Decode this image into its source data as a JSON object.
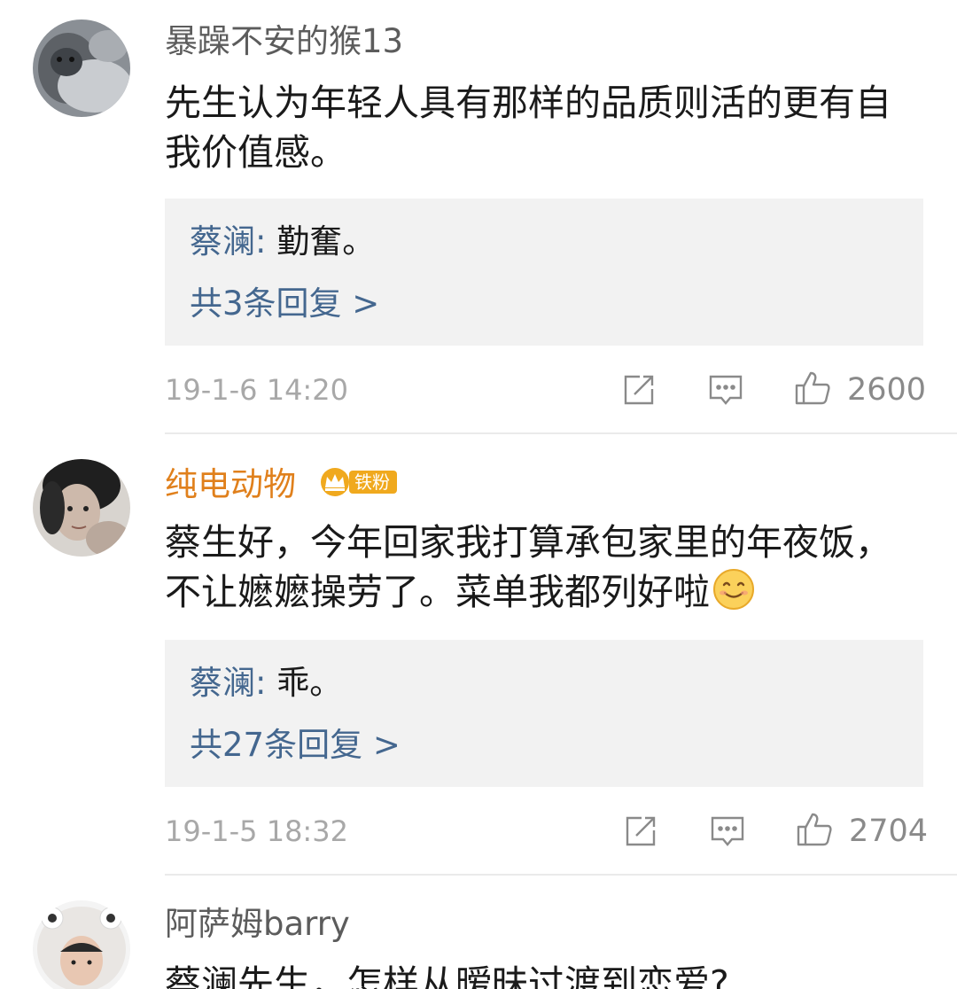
{
  "comments": [
    {
      "username": "暴躁不安的猴13",
      "text": "先生认为年轻人具有那样的品质则活的更有自我价值感。",
      "reply": {
        "author": "蔡澜",
        "separator": ": ",
        "text": "勤奮。"
      },
      "reply_count_label": "共3条回复 >",
      "time": "19-1-6 14:20",
      "likes": "2600"
    },
    {
      "username": "纯电动物",
      "vip_badge": "铁粉",
      "text": "蔡生好，今年回家我打算承包家里的年夜饭，不让嬷嬷操劳了。菜单我都列好啦",
      "reply": {
        "author": "蔡澜",
        "separator": ": ",
        "text": "乖。"
      },
      "reply_count_label": "共27条回复 >",
      "time": "19-1-5 18:32",
      "likes": "2704"
    },
    {
      "username": "阿萨姆barry",
      "text": "蔡澜先生，怎样从暧昧过渡到恋爱?"
    }
  ],
  "icons": {
    "share": "share-icon",
    "comment": "comment-icon",
    "like": "thumbs-up-icon",
    "emoji": "smile-emoji-icon",
    "vip": "crown-icon"
  },
  "colors": {
    "username": "#5c5c5c",
    "vip_username": "#e0801c",
    "reply_link": "#44678f",
    "reply_bg": "#f2f2f2",
    "meta": "#a8a8a8",
    "badge": "#f0a91e"
  }
}
